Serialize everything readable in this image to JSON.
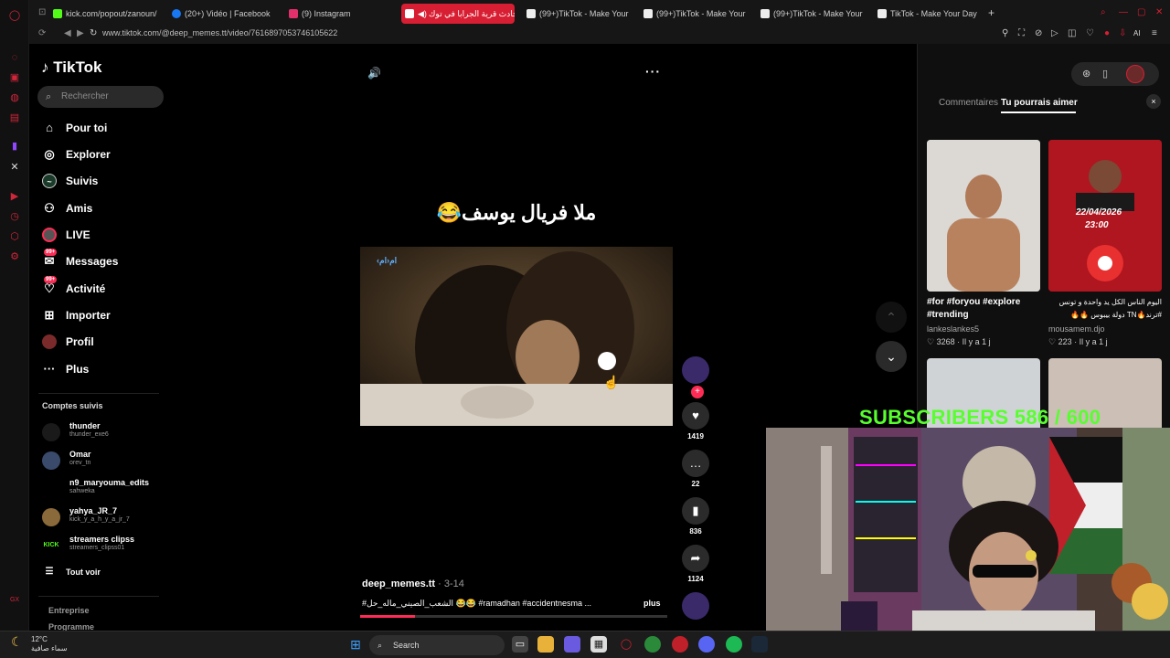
{
  "browser": {
    "tabs": [
      {
        "label": "kick.com/popout/zanoun/",
        "icon": "kick-icon",
        "color": "#53fc18"
      },
      {
        "label": "(20+) Vidéo | Facebook",
        "icon": "facebook-icon",
        "color": "#1877f2"
      },
      {
        "label": "(9) Instagram",
        "icon": "instagram-icon",
        "color": "#e1306c"
      },
      {
        "label": "حادث قرية الجرابا في توك",
        "icon": "tiktok-icon",
        "color": "#ffffff",
        "active": true
      },
      {
        "label": "(99+)TikTok - Make Your",
        "icon": "tiktok-icon",
        "color": "#ffffff"
      },
      {
        "label": "(99+)TikTok - Make Your",
        "icon": "tiktok-icon",
        "color": "#ffffff"
      },
      {
        "label": "(99+)TikTok - Make Your",
        "icon": "tiktok-icon",
        "color": "#ffffff"
      },
      {
        "label": "TikTok - Make Your Day",
        "icon": "tiktok-icon",
        "color": "#ffffff"
      }
    ],
    "new_tab": "+",
    "url": "www.tiktok.com/@deep_memes.tt/video/7616897053746105622",
    "ai_label": "AI"
  },
  "tiktok": {
    "logo": "TikTok",
    "search_placeholder": "Rechercher",
    "nav": [
      {
        "label": "Pour toi",
        "icon": "home-icon",
        "glyph": "⌂"
      },
      {
        "label": "Explorer",
        "icon": "compass-icon",
        "glyph": "◎"
      },
      {
        "label": "Suivis",
        "icon": "following-icon",
        "glyph": "◉"
      },
      {
        "label": "Amis",
        "icon": "friends-icon",
        "glyph": "👥"
      },
      {
        "label": "LIVE",
        "icon": "live-icon",
        "glyph": "●"
      },
      {
        "label": "Messages",
        "icon": "messages-icon",
        "glyph": "✉",
        "badge": "99+"
      },
      {
        "label": "Activité",
        "icon": "activity-icon",
        "glyph": "♥",
        "badge": "99+"
      },
      {
        "label": "Importer",
        "icon": "upload-icon",
        "glyph": "⊞"
      },
      {
        "label": "Profil",
        "icon": "profile-icon",
        "glyph": "●"
      },
      {
        "label": "Plus",
        "icon": "more-icon",
        "glyph": "···"
      }
    ],
    "following_title": "Comptes suivis",
    "accounts": [
      {
        "name": "thunder",
        "handle": "thunder_exe6"
      },
      {
        "name": "Omar",
        "handle": "orev_tn"
      },
      {
        "name": "n9_maryouma_edits",
        "handle": "sahweka"
      },
      {
        "name": "yahya_JR_7",
        "handle": "kick_y_a_h_y_a_jr_7"
      },
      {
        "name": "streamers clipss",
        "handle": "streamers_clipss01"
      }
    ],
    "see_all": "Tout voir",
    "footer": [
      "Entreprise",
      "Programme"
    ]
  },
  "video": {
    "overlay_text": "ملا فريال يوسف😂",
    "channel_watermark": "‹ام‹ام",
    "author": "deep_memes.tt",
    "date": "3-14",
    "description": "#الشعب_الصيني_ماله_حل 😂😂 #ramadhan #accidentnesma ...",
    "more": "plus",
    "progress": 0.18,
    "likes": "1419",
    "comments": "22",
    "saves": "836",
    "shares": "1124"
  },
  "right_panel": {
    "tabs": [
      "Commentaires",
      "Tu pourrais aimer"
    ],
    "active_tab": "Tu pourrais aimer",
    "close": "×",
    "cards": [
      {
        "caption": "#for #foryou #explore #trending",
        "author": "lankeslankes5",
        "likes": "3268",
        "time": "Il y a 1 j"
      },
      {
        "caption": "اليوم الناس الكل يد واحدة و تونس #ترند🔥TN دولة بيبوس 🔥🔥",
        "author": "mousamem.djo",
        "likes": "223",
        "time": "Il y a 1 j",
        "poster_date": "22/04/2026",
        "poster_time": "23:00"
      },
      {
        "caption": "",
        "author": "",
        "likes": "",
        "time": ""
      },
      {
        "caption": "",
        "author": "",
        "likes": "",
        "time": ""
      }
    ]
  },
  "stream_overlay": {
    "subscribers_text": "SUBSCRIBERS 586 / 600"
  },
  "taskbar": {
    "temp": "12°C",
    "weather": "سماء صافية",
    "search": "Search"
  }
}
